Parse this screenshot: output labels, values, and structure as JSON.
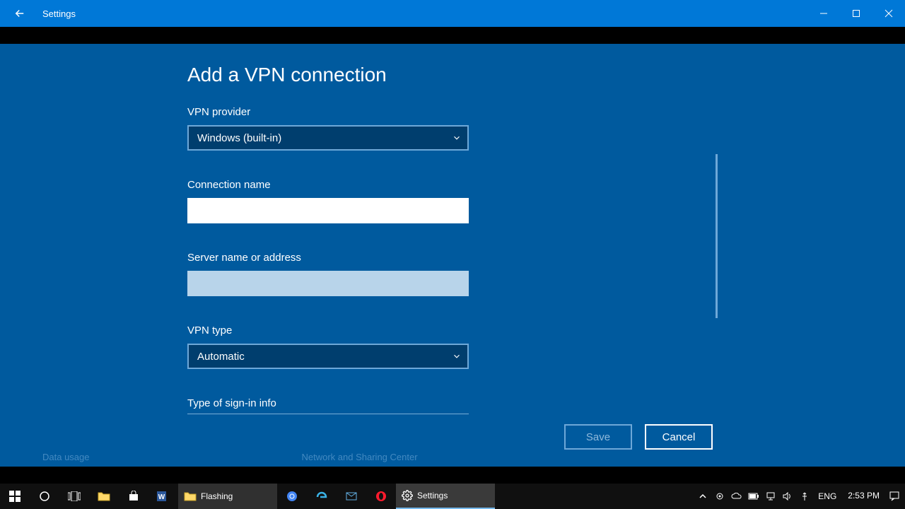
{
  "window": {
    "title": "Settings"
  },
  "page": {
    "heading": "Add a VPN connection",
    "provider_label": "VPN provider",
    "provider_value": "Windows (built-in)",
    "connection_label": "Connection name",
    "connection_value": "",
    "server_label": "Server name or address",
    "server_value": "",
    "vpn_type_label": "VPN type",
    "vpn_type_value": "Automatic",
    "signin_label": "Type of sign-in info",
    "save_label": "Save",
    "cancel_label": "Cancel"
  },
  "background": {
    "item1": "Data usage",
    "item2": "Network and Sharing Center"
  },
  "taskbar": {
    "explorer_label": "Flashing",
    "settings_label": "Settings",
    "lang": "ENG",
    "time": "2:53 PM"
  }
}
